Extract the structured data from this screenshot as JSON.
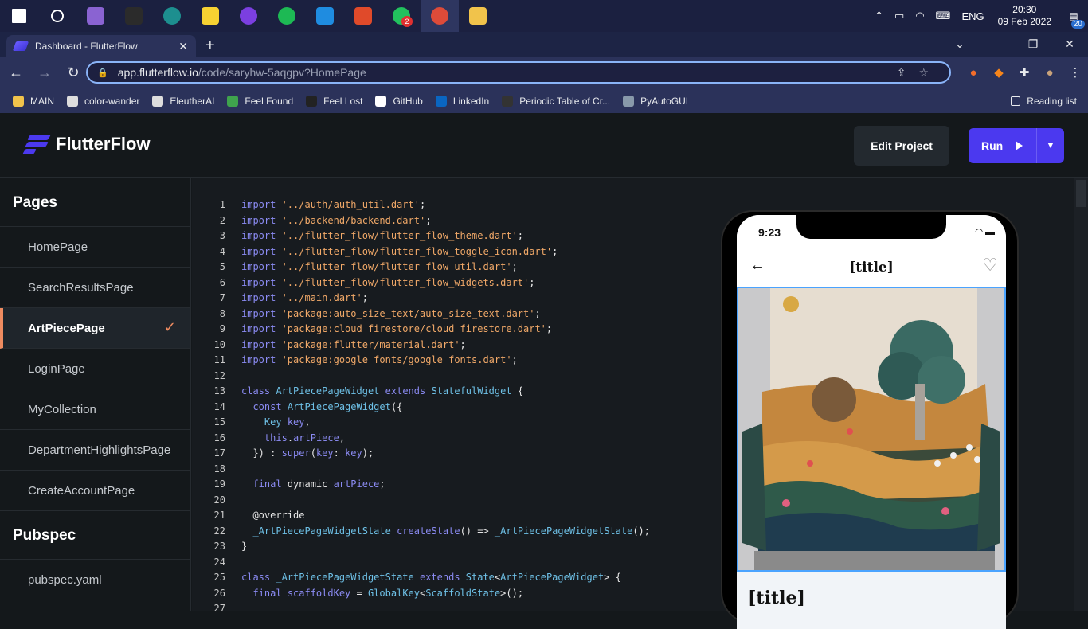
{
  "taskbar": {
    "apps": [
      {
        "name": "start",
        "color": "#ffffff"
      },
      {
        "name": "search",
        "color": "#ffffff"
      },
      {
        "name": "git-kraken",
        "color": "#8a63d2"
      },
      {
        "name": "terminal",
        "color": "#2b2b2b"
      },
      {
        "name": "pycharm",
        "color": "#1d8f8f"
      },
      {
        "name": "sticky-notes",
        "color": "#f7d232"
      },
      {
        "name": "podcast",
        "color": "#7b3fe0"
      },
      {
        "name": "spotify",
        "color": "#1db954"
      },
      {
        "name": "vscode",
        "color": "#1f8ce0"
      },
      {
        "name": "office",
        "color": "#e04a2a"
      },
      {
        "name": "whatsapp",
        "color": "#22c15e"
      },
      {
        "name": "chrome",
        "color": "#dd4b39"
      },
      {
        "name": "file-explorer",
        "color": "#f1c34b"
      }
    ],
    "whatsapp_badge": "2",
    "language": "ENG",
    "time": "20:30",
    "date": "09 Feb 2022",
    "notifications": "20"
  },
  "browser": {
    "tab_title": "Dashboard - FlutterFlow",
    "url_host": "app.flutterflow.io",
    "url_path": "/code/saryhw-5aqgpv?HomePage",
    "bookmarks": [
      {
        "label": "MAIN",
        "color": "#f1c34b"
      },
      {
        "label": "color-wander",
        "color": "#dddddd"
      },
      {
        "label": "EleutherAI",
        "color": "#dddddd"
      },
      {
        "label": "Feel Found",
        "color": "#3fa34d"
      },
      {
        "label": "Feel Lost",
        "color": "#222222"
      },
      {
        "label": "GitHub",
        "color": "#ffffff"
      },
      {
        "label": "LinkedIn",
        "color": "#0a66c2"
      },
      {
        "label": "Periodic Table of Cr...",
        "color": "#333333"
      },
      {
        "label": "PyAutoGUI",
        "color": "#8899aa"
      }
    ],
    "reading_list": "Reading list"
  },
  "app": {
    "brand": "FlutterFlow",
    "edit_project": "Edit Project",
    "run": "Run"
  },
  "sidebar": {
    "pages_header": "Pages",
    "pages": [
      {
        "label": "HomePage",
        "selected": false
      },
      {
        "label": "SearchResultsPage",
        "selected": false
      },
      {
        "label": "ArtPiecePage",
        "selected": true
      },
      {
        "label": "LoginPage",
        "selected": false
      },
      {
        "label": "MyCollection",
        "selected": false
      },
      {
        "label": "DepartmentHighlightsPage",
        "selected": false
      },
      {
        "label": "CreateAccountPage",
        "selected": false
      }
    ],
    "pubspec_header": "Pubspec",
    "pubspec_file": "pubspec.yaml"
  },
  "code": [
    [
      [
        "kw",
        "import "
      ],
      [
        "str",
        "'../auth/auth_util.dart'"
      ],
      [
        "pl",
        ";"
      ]
    ],
    [
      [
        "kw",
        "import "
      ],
      [
        "str",
        "'../backend/backend.dart'"
      ],
      [
        "pl",
        ";"
      ]
    ],
    [
      [
        "kw",
        "import "
      ],
      [
        "str",
        "'../flutter_flow/flutter_flow_theme.dart'"
      ],
      [
        "pl",
        ";"
      ]
    ],
    [
      [
        "kw",
        "import "
      ],
      [
        "str",
        "'../flutter_flow/flutter_flow_toggle_icon.dart'"
      ],
      [
        "pl",
        ";"
      ]
    ],
    [
      [
        "kw",
        "import "
      ],
      [
        "str",
        "'../flutter_flow/flutter_flow_util.dart'"
      ],
      [
        "pl",
        ";"
      ]
    ],
    [
      [
        "kw",
        "import "
      ],
      [
        "str",
        "'../flutter_flow/flutter_flow_widgets.dart'"
      ],
      [
        "pl",
        ";"
      ]
    ],
    [
      [
        "kw",
        "import "
      ],
      [
        "str",
        "'../main.dart'"
      ],
      [
        "pl",
        ";"
      ]
    ],
    [
      [
        "kw",
        "import "
      ],
      [
        "str",
        "'package:auto_size_text/auto_size_text.dart'"
      ],
      [
        "pl",
        ";"
      ]
    ],
    [
      [
        "kw",
        "import "
      ],
      [
        "str",
        "'package:cloud_firestore/cloud_firestore.dart'"
      ],
      [
        "pl",
        ";"
      ]
    ],
    [
      [
        "kw",
        "import "
      ],
      [
        "str",
        "'package:flutter/material.dart'"
      ],
      [
        "pl",
        ";"
      ]
    ],
    [
      [
        "kw",
        "import "
      ],
      [
        "str",
        "'package:google_fonts/google_fonts.dart'"
      ],
      [
        "pl",
        ";"
      ]
    ],
    [],
    [
      [
        "kw",
        "class "
      ],
      [
        "cls",
        "ArtPiecePageWidget "
      ],
      [
        "kw",
        "extends "
      ],
      [
        "cls",
        "StatefulWidget"
      ],
      [
        "pl",
        " {"
      ]
    ],
    [
      [
        "pl",
        "  "
      ],
      [
        "kw",
        "const "
      ],
      [
        "cls",
        "ArtPiecePageWidget"
      ],
      [
        "pl",
        "({"
      ]
    ],
    [
      [
        "pl",
        "    "
      ],
      [
        "cls",
        "Key "
      ],
      [
        "kw",
        "key"
      ],
      [
        "pl",
        ","
      ]
    ],
    [
      [
        "pl",
        "    "
      ],
      [
        "kw",
        "this"
      ],
      [
        "pl",
        "."
      ],
      [
        "kw",
        "artPiece"
      ],
      [
        "pl",
        ","
      ]
    ],
    [
      [
        "pl",
        "  }) : "
      ],
      [
        "kw",
        "super"
      ],
      [
        "pl",
        "("
      ],
      [
        "kw",
        "key"
      ],
      [
        "pl",
        ": "
      ],
      [
        "kw",
        "key"
      ],
      [
        "pl",
        ");"
      ]
    ],
    [],
    [
      [
        "pl",
        "  "
      ],
      [
        "kw",
        "final "
      ],
      [
        "pl",
        "dynamic "
      ],
      [
        "kw",
        "artPiece"
      ],
      [
        "pl",
        ";"
      ]
    ],
    [],
    [
      [
        "pl",
        "  @override"
      ]
    ],
    [
      [
        "pl",
        "  "
      ],
      [
        "cls",
        "_ArtPiecePageWidgetState "
      ],
      [
        "kw",
        "createState"
      ],
      [
        "pl",
        "() => "
      ],
      [
        "cls",
        "_ArtPiecePageWidgetState"
      ],
      [
        "pl",
        "();"
      ]
    ],
    [
      [
        "pl",
        "}"
      ]
    ],
    [],
    [
      [
        "kw",
        "class "
      ],
      [
        "cls",
        "_ArtPiecePageWidgetState "
      ],
      [
        "kw",
        "extends "
      ],
      [
        "cls",
        "State"
      ],
      [
        "pl",
        "<"
      ],
      [
        "cls",
        "ArtPiecePageWidget"
      ],
      [
        "pl",
        "> {"
      ]
    ],
    [
      [
        "pl",
        "  "
      ],
      [
        "kw",
        "final "
      ],
      [
        "kw",
        "scaffoldKey "
      ],
      [
        "pl",
        "= "
      ],
      [
        "cls",
        "GlobalKey"
      ],
      [
        "pl",
        "<"
      ],
      [
        "cls",
        "ScaffoldState"
      ],
      [
        "pl",
        ">();"
      ]
    ],
    []
  ],
  "phone": {
    "time": "9:23",
    "appbar_title": "[title]",
    "page_title": "[title]"
  }
}
